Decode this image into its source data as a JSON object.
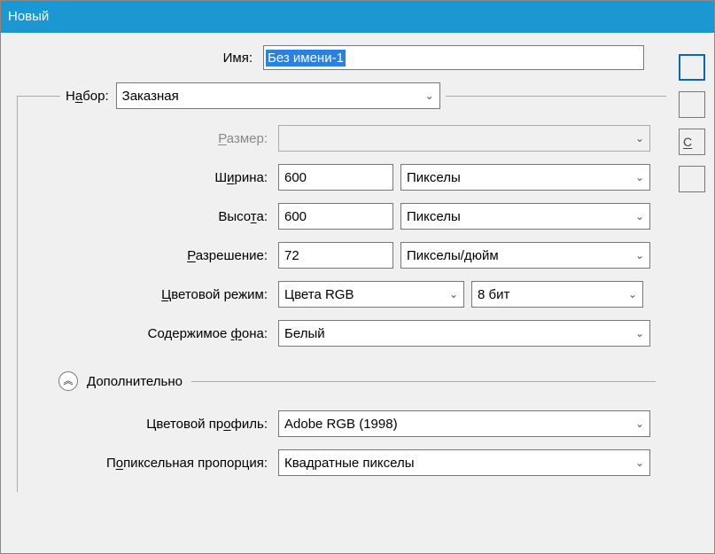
{
  "title": "Новый",
  "labels": {
    "name": "Имя:",
    "preset": {
      "pre": "Н",
      "u": "а",
      "post": "бор:"
    },
    "size": {
      "pre": "",
      "u": "Р",
      "post": "азмер:"
    },
    "width": {
      "pre": "Ш",
      "u": "и",
      "post": "рина:"
    },
    "height": {
      "pre": "Высо",
      "u": "т",
      "post": "а:"
    },
    "resolution": {
      "pre": "",
      "u": "Р",
      "post": "азрешение:"
    },
    "colormode": {
      "pre": "",
      "u": "Ц",
      "post": "ветовой режим:"
    },
    "bgcontents": {
      "pre": "Содержимое ",
      "u": "ф",
      "post": "она:"
    },
    "advanced": "Дополнительно",
    "colorprofile": {
      "pre": "Цветовой пр",
      "u": "о",
      "post": "филь:"
    },
    "pixelaspect": {
      "pre": "П",
      "u": "о",
      "post": "пиксельная пропорция:"
    }
  },
  "values": {
    "name": "Без имени-1",
    "preset": "Заказная",
    "size": "",
    "width": "600",
    "width_unit": "Пикселы",
    "height": "600",
    "height_unit": "Пикселы",
    "resolution": "72",
    "resolution_unit": "Пикселы/дюйм",
    "colormode": "Цвета RGB",
    "colordepth": "8 бит",
    "bgcontents": "Белый",
    "colorprofile": "Adobe RGB (1998)",
    "pixelaspect": "Квадратные пикселы"
  },
  "sidebar": {
    "save_u": "С"
  },
  "icons": {
    "chevron_down": "⌄",
    "chevron_up": "︽"
  }
}
